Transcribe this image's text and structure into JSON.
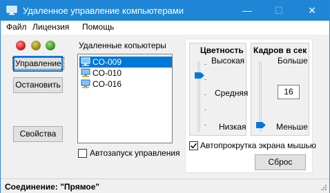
{
  "window": {
    "title": "Удаленное управление компьютерами",
    "controls": {
      "minimize": "—",
      "maximize": "☐",
      "close": "✕"
    }
  },
  "menu": {
    "items": [
      "Файл",
      "Лицензия",
      "Помощь"
    ]
  },
  "left_panel": {
    "indicators": [
      {
        "name": "red",
        "color": "#d61f1f"
      },
      {
        "name": "yellow",
        "color": "#9a8a12"
      },
      {
        "name": "green",
        "color": "#3f9a1f"
      }
    ],
    "buttons": {
      "manage": "Управление",
      "stop": "Остановить",
      "properties": "Свойства"
    }
  },
  "computers": {
    "label": "Удаленные копьютеры",
    "items": [
      {
        "name": "CO-009",
        "selected": true
      },
      {
        "name": "CO-010",
        "selected": false
      },
      {
        "name": "CO-016",
        "selected": false
      }
    ],
    "autostart_label": "Автозапуск управления",
    "autostart_checked": false
  },
  "color_depth": {
    "title": "Цветность",
    "high_label": "Высокая",
    "mid_label": "Средняя",
    "low_label": "Низкая",
    "level": 0.83
  },
  "fps": {
    "title": "Кадров в сек",
    "more_label": "Больше",
    "less_label": "Меньше",
    "value": "16",
    "level": 0.05
  },
  "autoscroll": {
    "label": "Автопрокрутка экрана мышью",
    "checked": true
  },
  "reset_button": "Сброс",
  "status": {
    "text": "Соединение: \"Прямое\""
  },
  "colors": {
    "titlebar": "#1e86d6",
    "accent": "#0078d7",
    "selection": "#0078d7"
  }
}
